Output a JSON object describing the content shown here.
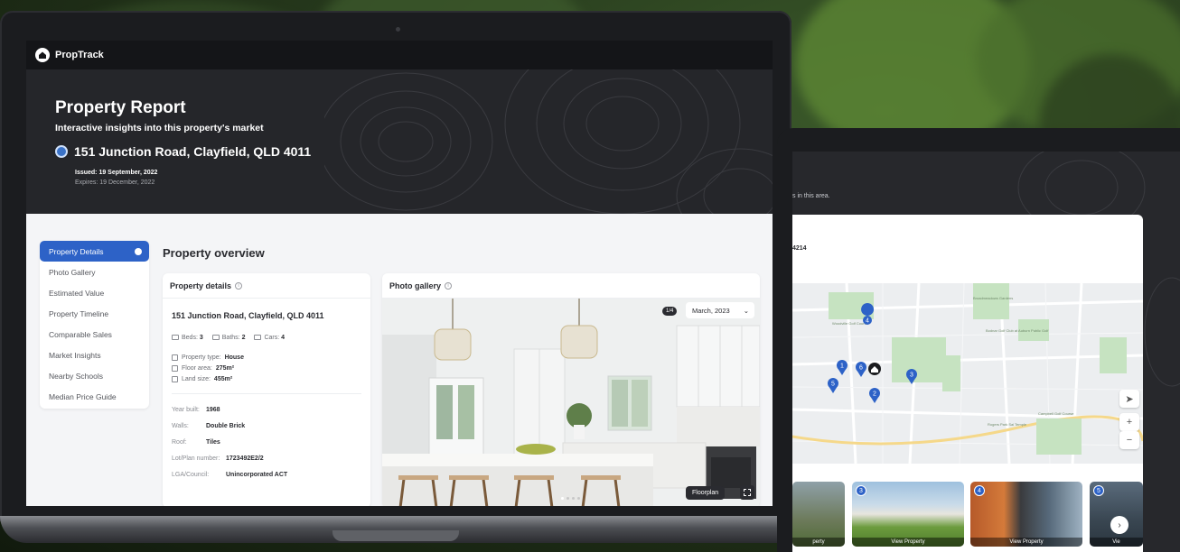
{
  "brand": {
    "name": "PropTrack"
  },
  "hero": {
    "title": "Property Report",
    "subtitle": "Interactive insights into this property's market",
    "address": "151 Junction Road, Clayfield, QLD 4011",
    "issued": "Issued: 19 September, 2022",
    "expires": "Expires: 19 December, 2022"
  },
  "sidebar": {
    "items": [
      {
        "label": "Property Details"
      },
      {
        "label": "Photo Gallery"
      },
      {
        "label": "Estimated Value"
      },
      {
        "label": "Property Timeline"
      },
      {
        "label": "Comparable Sales"
      },
      {
        "label": "Market Insights"
      },
      {
        "label": "Nearby Schools"
      },
      {
        "label": "Median Price Guide"
      }
    ]
  },
  "overview": {
    "title": "Property overview"
  },
  "property_details": {
    "heading": "Property details",
    "address": "151 Junction Road, Clayfield, QLD 4011",
    "beds_label": "Beds:",
    "beds": "3",
    "baths_label": "Baths:",
    "baths": "2",
    "cars_label": "Cars:",
    "cars": "4",
    "type_label": "Property type:",
    "type": "House",
    "floor_label": "Floor area:",
    "floor": "275m²",
    "land_label": "Land size:",
    "land": "455m²",
    "year_label": "Year built:",
    "year": "1968",
    "walls_label": "Walls:",
    "walls": "Double Brick",
    "roof_label": "Roof:",
    "roof": "Tiles",
    "lot_label": "Lot/Plan number:",
    "lot": "1723492E2/2",
    "lga_label": "LGA/Council:",
    "lga": "Unincorporated ACT"
  },
  "photo_gallery": {
    "heading": "Photo gallery",
    "counter": "1/4",
    "date": "March, 2023",
    "floorplan": "Floorplan"
  },
  "tablet": {
    "area_text": "s in this area.",
    "postcode": "4214",
    "map_places": [
      "Woodville Golf Course",
      "Bodnar Golf Club at Auburn Public Golf",
      "Campbell Golf Course",
      "Rogers Park Sai Temple",
      "Broadmeadows Gardens"
    ],
    "thumb_caption_1": "perty",
    "thumb_caption_2": "View Property",
    "thumb_caption_3": "View Property",
    "thumb_caption_4": "Vie",
    "badges": [
      "3",
      "4",
      "5"
    ],
    "markers": [
      "4",
      "1",
      "6",
      "3",
      "5",
      "2"
    ],
    "zoom_in": "+",
    "zoom_out": "−",
    "next": "›"
  },
  "colors": {
    "accent": "#2d62c7",
    "dark": "#25262a"
  }
}
